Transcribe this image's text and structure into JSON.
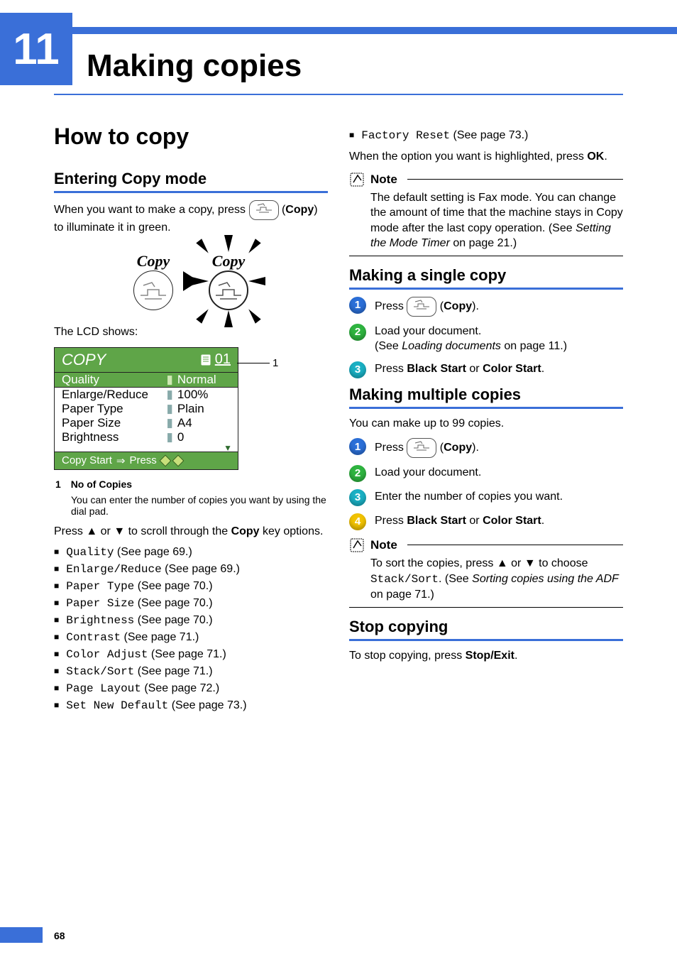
{
  "chapter": {
    "number": "11",
    "title": "Making copies"
  },
  "left": {
    "h2": "How to copy",
    "entering": {
      "heading": "Entering Copy mode",
      "intro_pre": "When you want to make a copy, press ",
      "intro_copy": "Copy",
      "intro_post": ") to illuminate it in green.",
      "diagram_label": "Copy",
      "lcd_shows": "The LCD shows:",
      "lcd": {
        "title": "COPY",
        "count": "01",
        "selected_key": "Quality",
        "selected_val": "Normal",
        "rows": [
          {
            "k": "Enlarge/Reduce",
            "v": "100%"
          },
          {
            "k": "Paper Type",
            "v": "Plain"
          },
          {
            "k": "Paper Size",
            "v": "A4"
          },
          {
            "k": "Brightness",
            "v": "0"
          }
        ],
        "footer_pre": "Copy Start",
        "footer_arrow": "⇒",
        "footer_post": "Press"
      },
      "callout_num": "1",
      "footnote_num": "1",
      "footnote_title": "No of Copies",
      "footnote_body": "You can enter the number of copies you want by using the dial pad.",
      "scroll_instr_pre": "Press ",
      "scroll_instr_mid": " or ",
      "scroll_instr_post": " to scroll through the ",
      "scroll_instr_bold": "Copy",
      "scroll_instr_end": " key options.",
      "options": [
        {
          "code": "Quality",
          "ref": " (See page 69.)"
        },
        {
          "code": "Enlarge/Reduce",
          "ref": " (See page 69.)"
        },
        {
          "code": "Paper Type",
          "ref": " (See page 70.)"
        },
        {
          "code": "Paper Size",
          "ref": " (See page 70.)"
        },
        {
          "code": "Brightness",
          "ref": " (See page 70.)"
        },
        {
          "code": "Contrast",
          "ref": " (See page 71.)"
        },
        {
          "code": "Color Adjust",
          "ref": " (See page 71.)"
        },
        {
          "code": "Stack/Sort",
          "ref": " (See page 71.)"
        },
        {
          "code": "Page Layout",
          "ref": " (See page 72.)"
        },
        {
          "code": "Set New Default",
          "ref": " (See page 73.)"
        }
      ]
    }
  },
  "right": {
    "factory_reset_code": "Factory Reset",
    "factory_reset_ref": " (See page 73.)",
    "highlight_pre": "When the option you want is highlighted, press ",
    "highlight_bold": "OK",
    "highlight_post": ".",
    "note1_label": "Note",
    "note1_body_1": "The default setting is Fax mode. You can change the amount of time that the machine stays in Copy mode after the last copy operation. (See ",
    "note1_italic": "Setting the Mode Timer",
    "note1_body_2": " on page 21.)",
    "single": {
      "heading": "Making a single copy",
      "s1_pre": "Press ",
      "s1_copy": "Copy",
      "s1_post": ").",
      "s2_line1": "Load your document.",
      "s2_line2_pre": "(See ",
      "s2_line2_italic": "Loading documents",
      "s2_line2_post": " on page 11.)",
      "s3_pre": "Press ",
      "s3_b1": "Black Start",
      "s3_mid": " or ",
      "s3_b2": "Color Start",
      "s3_post": "."
    },
    "multiple": {
      "heading": "Making multiple copies",
      "intro": "You can make up to 99 copies.",
      "s1_pre": "Press ",
      "s1_copy": "Copy",
      "s1_post": ").",
      "s2": "Load your document.",
      "s3": "Enter the number of copies you want.",
      "s4_pre": "Press ",
      "s4_b1": "Black Start",
      "s4_mid": " or ",
      "s4_b2": "Color Start",
      "s4_post": ".",
      "note_label": "Note",
      "note_pre": "To sort the copies, press ",
      "note_mid": " or ",
      "note_post": " to choose ",
      "note_code": "Stack/Sort",
      "note_after": ". (See ",
      "note_italic": "Sorting copies using the ADF",
      "note_end": " on page 71.)"
    },
    "stop": {
      "heading": "Stop copying",
      "body_pre": "To stop copying, press ",
      "body_bold": "Stop/Exit",
      "body_post": "."
    }
  },
  "page_number": "68"
}
